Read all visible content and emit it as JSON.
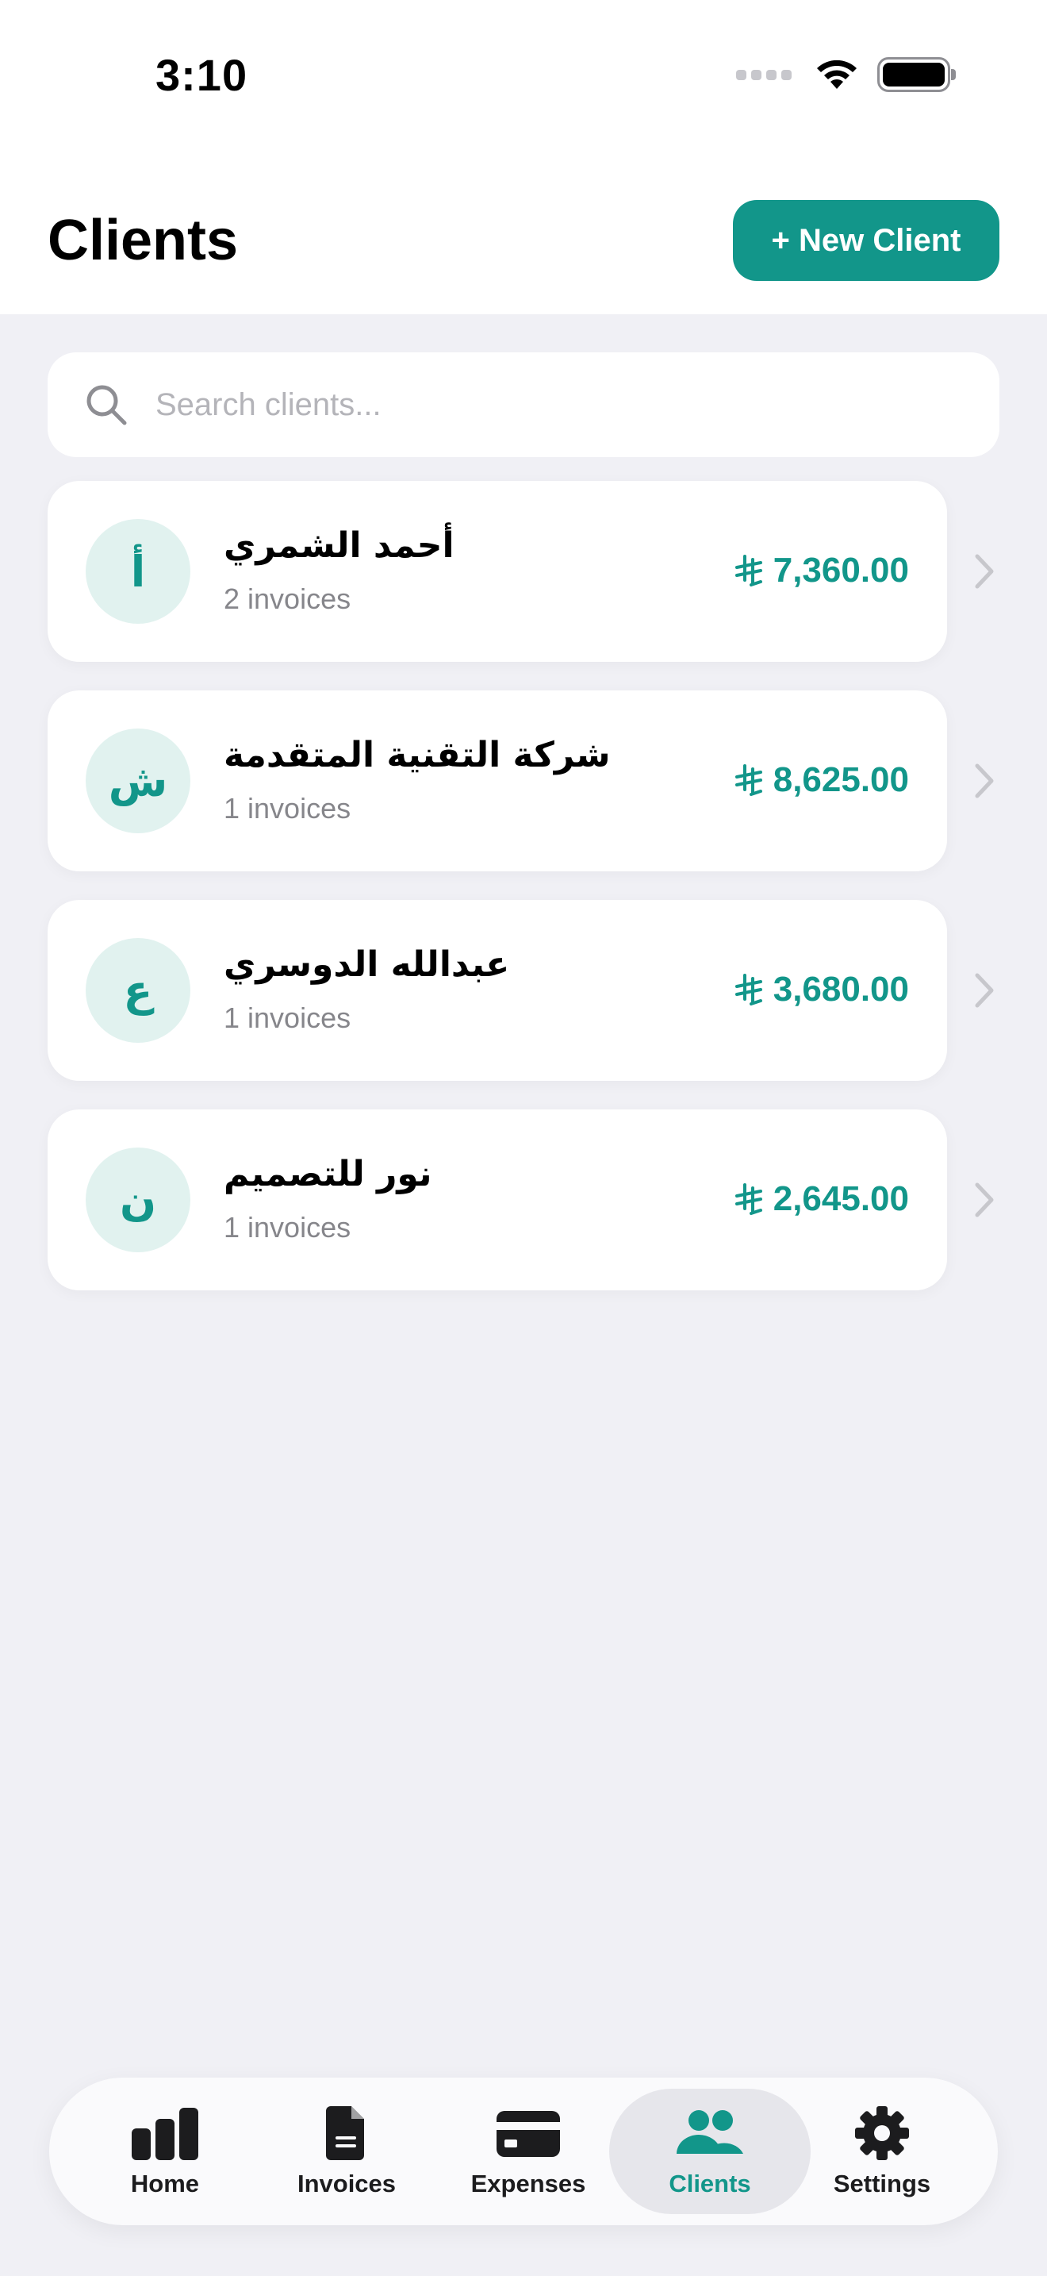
{
  "status_bar": {
    "time": "3:10"
  },
  "header": {
    "title": "Clients",
    "new_client_label": "+ New Client"
  },
  "search": {
    "placeholder": "Search clients...",
    "value": ""
  },
  "clients": [
    {
      "initial": "أ",
      "name": "أحمد الشمري",
      "invoices": "2 invoices",
      "amount": "7,360.00"
    },
    {
      "initial": "ش",
      "name": "شركة التقنية المتقدمة",
      "invoices": "1 invoices",
      "amount": "8,625.00"
    },
    {
      "initial": "ع",
      "name": "عبدالله الدوسري",
      "invoices": "1 invoices",
      "amount": "3,680.00"
    },
    {
      "initial": "ن",
      "name": "نور للتصميم",
      "invoices": "1 invoices",
      "amount": "2,645.00"
    }
  ],
  "tab_bar": {
    "tabs": [
      {
        "label": "Home",
        "icon": "chart-bar-icon"
      },
      {
        "label": "Invoices",
        "icon": "document-icon"
      },
      {
        "label": "Expenses",
        "icon": "credit-card-icon"
      },
      {
        "label": "Clients",
        "icon": "people-icon",
        "active": true
      },
      {
        "label": "Settings",
        "icon": "gear-icon"
      }
    ]
  },
  "colors": {
    "accent": "#12968a",
    "avatar_bg": "#e1f2ef",
    "page_bg": "#f0f0f5",
    "secondary_text": "#86868b"
  }
}
